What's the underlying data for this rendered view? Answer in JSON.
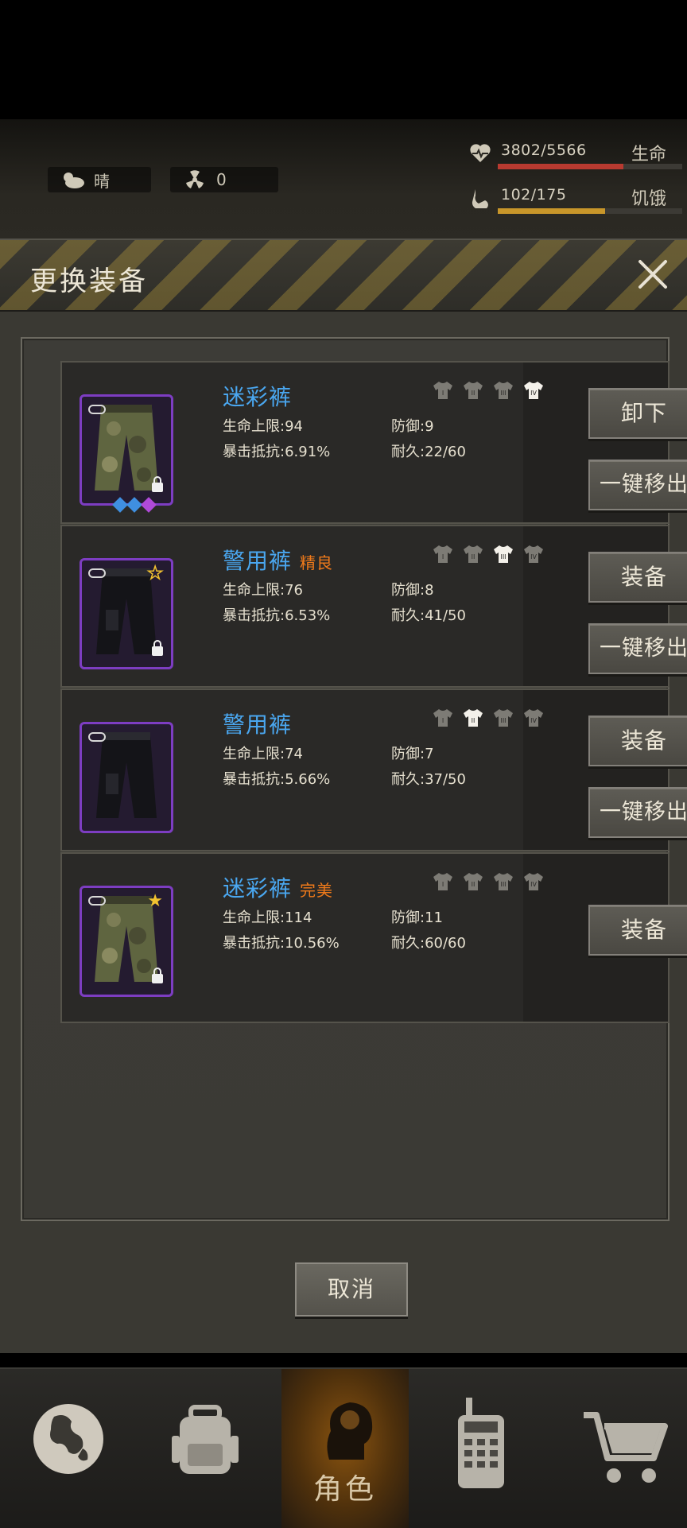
{
  "hud": {
    "weather": "晴",
    "radiation": "0",
    "hp": {
      "text": "3802/5566",
      "label": "生命",
      "fraction": 0.683,
      "color": "#b83a30"
    },
    "hunger": {
      "text": "102/175",
      "label": "饥饿",
      "fraction": 0.583,
      "color": "#c8962a"
    }
  },
  "modal": {
    "title": "更换装备",
    "cancel_label": "取消",
    "items": [
      {
        "name": "迷彩裤",
        "quality": "",
        "hp_max": "生命上限:94",
        "crit_res": "暴击抵抗:6.91%",
        "defense": "防御:9",
        "durability": "耐久:22/60",
        "primary_action": "卸下",
        "secondary_action": "一键移出",
        "active_slot": 4,
        "kind": "camo",
        "star": "",
        "gems": [
          "#3f8fe0",
          "#3f8fe0",
          "#b04ad8"
        ]
      },
      {
        "name": "警用裤",
        "quality": "精良",
        "hp_max": "生命上限:76",
        "crit_res": "暴击抵抗:6.53%",
        "defense": "防御:8",
        "durability": "耐久:41/50",
        "primary_action": "装备",
        "secondary_action": "一键移出",
        "active_slot": 3,
        "kind": "police",
        "star": "outline",
        "gems": []
      },
      {
        "name": "警用裤",
        "quality": "",
        "hp_max": "生命上限:74",
        "crit_res": "暴击抵抗:5.66%",
        "defense": "防御:7",
        "durability": "耐久:37/50",
        "primary_action": "装备",
        "secondary_action": "一键移出",
        "active_slot": 2,
        "kind": "police",
        "star": "",
        "gems": []
      },
      {
        "name": "迷彩裤",
        "quality": "完美",
        "hp_max": "生命上限:114",
        "crit_res": "暴击抵抗:10.56%",
        "defense": "防御:11",
        "durability": "耐久:60/60",
        "primary_action": "装备",
        "secondary_action": "",
        "active_slot": 0,
        "kind": "camo",
        "star": "filled",
        "gems": []
      }
    ]
  },
  "nav": {
    "items": [
      {
        "icon": "globe-icon",
        "label": ""
      },
      {
        "icon": "backpack-icon",
        "label": ""
      },
      {
        "icon": "character-head-icon",
        "label": "角色"
      },
      {
        "icon": "walkie-talkie-icon",
        "label": ""
      },
      {
        "icon": "shopping-cart-icon",
        "label": ""
      }
    ]
  }
}
